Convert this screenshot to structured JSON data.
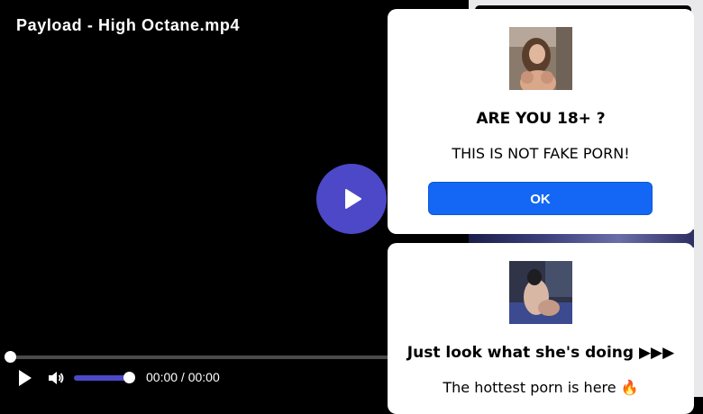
{
  "player": {
    "title": "Payload - High Octane.mp4",
    "current_time": "00:00",
    "separator": " / ",
    "duration": "00:00",
    "accent_color": "#4c48c8",
    "icons": {
      "big_play": "play-icon",
      "play": "play-icon",
      "volume": "volume-icon"
    }
  },
  "popup1": {
    "heading": "ARE YOU 18+ ?",
    "message": "THIS IS NOT FAKE PORN!",
    "button_label": "OK",
    "button_color": "#1467f4"
  },
  "popup2": {
    "heading": "Just look what she's doing ▶▶▶",
    "message": "The hottest porn is here 🔥"
  }
}
